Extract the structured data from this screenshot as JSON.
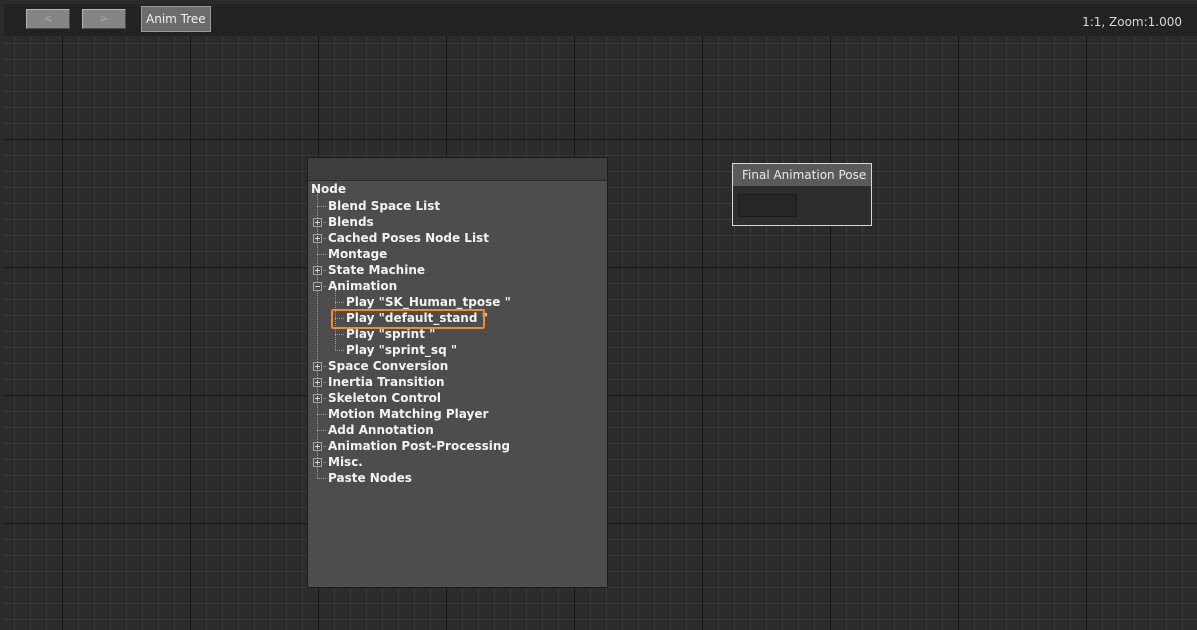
{
  "toolbar": {
    "back_label": "<",
    "forward_label": ">",
    "tab_label": "Anim Tree",
    "zoom_readout": "1:1, Zoom:1.000"
  },
  "context_menu": {
    "root_label": "Node",
    "items": [
      {
        "label": "Blend Space List",
        "state": "leaf"
      },
      {
        "label": "Blends",
        "state": "collapsed"
      },
      {
        "label": "Cached Poses Node List",
        "state": "collapsed"
      },
      {
        "label": "Montage",
        "state": "leaf"
      },
      {
        "label": "State Machine",
        "state": "collapsed"
      },
      {
        "label": "Animation",
        "state": "expanded"
      },
      {
        "label": "Play \"SK_Human_tpose \"",
        "state": "child"
      },
      {
        "label": "Play \"default_stand \"",
        "state": "child",
        "highlighted": true
      },
      {
        "label": "Play \"sprint \"",
        "state": "child"
      },
      {
        "label": "Play \"sprint_sq \"",
        "state": "child"
      },
      {
        "label": "Space Conversion",
        "state": "collapsed"
      },
      {
        "label": "Inertia Transition",
        "state": "collapsed"
      },
      {
        "label": "Skeleton Control",
        "state": "collapsed"
      },
      {
        "label": "Motion Matching Player",
        "state": "leaf"
      },
      {
        "label": "Add Annotation",
        "state": "leaf"
      },
      {
        "label": "Animation Post-Processing",
        "state": "collapsed"
      },
      {
        "label": "Misc.",
        "state": "collapsed"
      },
      {
        "label": "Paste Nodes",
        "state": "leaf"
      }
    ]
  },
  "final_pose_node": {
    "title": "Final Animation Pose"
  },
  "colors": {
    "highlight": "#f08a2a",
    "canvas_bg": "#2b2b2b",
    "menu_bg": "#4d4d4d"
  }
}
